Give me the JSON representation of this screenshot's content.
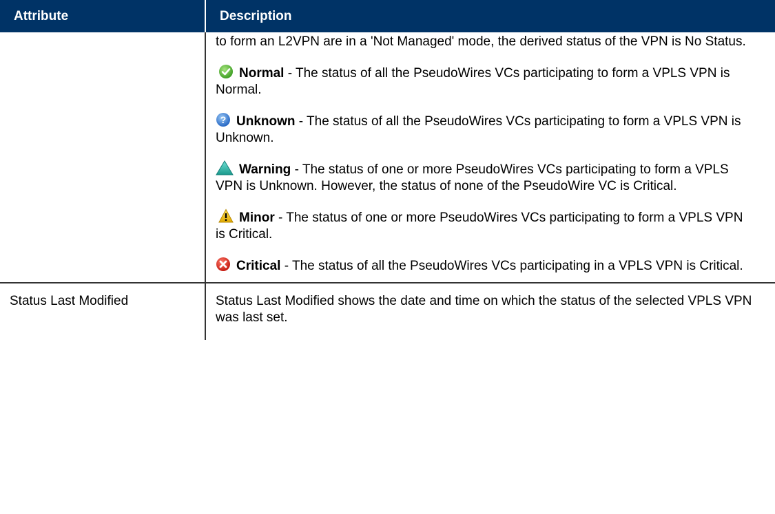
{
  "table": {
    "headers": {
      "attribute": "Attribute",
      "description": "Description"
    },
    "rows": [
      {
        "attribute": "",
        "intro": "to form an L2VPN are in a 'Not Managed' mode, the derived status of the VPN is No Status.",
        "statuses": [
          {
            "icon": "normal-check-icon",
            "color": "#5fbf3a",
            "label": "Normal",
            "text": " - The status of all the PseudoWires VCs participating to form a VPLS VPN is Normal."
          },
          {
            "icon": "unknown-question-icon",
            "color": "#3b82d6",
            "label": "Unknown",
            "text": " - The status of all the PseudoWires VCs participating to form a VPLS VPN is Unknown."
          },
          {
            "icon": "warning-triangle-icon",
            "color": "#2fb5a8",
            "label": "Warning",
            "text": " - The status of one or more PseudoWires VCs participating to form a VPLS VPN is Unknown. However, the status of none of the PseudoWire VC is Critical."
          },
          {
            "icon": "minor-alert-icon",
            "color": "#f2c200",
            "label": "Minor",
            "text": " - The status of one or more PseudoWires VCs participating to form a VPLS VPN is Critical."
          },
          {
            "icon": "critical-x-icon",
            "color": "#d9261c",
            "label": "Critical",
            "text": " - The status of all the PseudoWires VCs participating in a VPLS VPN is Critical."
          }
        ]
      },
      {
        "attribute": "Status Last Modified",
        "description": "Status Last Modified shows the date and time on which the status of the selected VPLS VPN was last set."
      }
    ]
  }
}
